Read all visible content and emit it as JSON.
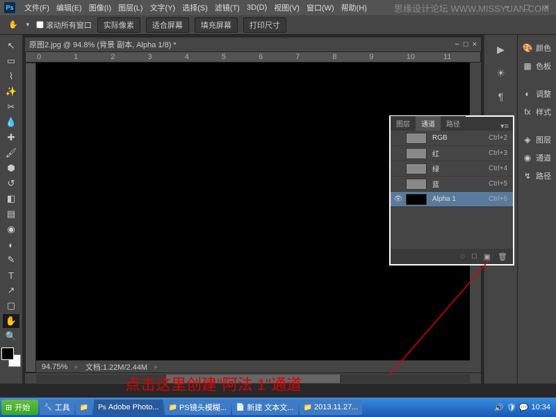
{
  "watermark": "思缘设计论坛  WWW.MISSYUAN.COM",
  "menubar": [
    "文件(F)",
    "编辑(E)",
    "图像(I)",
    "图层(L)",
    "文字(Y)",
    "选择(S)",
    "滤镜(T)",
    "3D(D)",
    "视图(V)",
    "窗口(W)",
    "帮助(H)"
  ],
  "optbar": {
    "scroll_all": "滚动所有窗口",
    "buttons": [
      "实际像素",
      "适合屏幕",
      "填充屏幕",
      "打印尺寸"
    ]
  },
  "doc_title": "原图2.jpg @ 94.8% (背景 副本, Alpha 1/8) *",
  "ruler_marks": [
    "0",
    "1",
    "2",
    "3",
    "4",
    "5",
    "6",
    "7",
    "8",
    "9",
    "10",
    "11"
  ],
  "status": {
    "zoom": "94.75%",
    "doc": "文档:1.22M/2.44M"
  },
  "channels_panel": {
    "tabs": [
      "图层",
      "通道",
      "路径"
    ],
    "active_tab": 1,
    "rows": [
      {
        "name": "RGB",
        "shortcut": "Ctrl+2",
        "eye": false,
        "thumb": "img"
      },
      {
        "name": "红",
        "shortcut": "Ctrl+3",
        "eye": false,
        "thumb": "img"
      },
      {
        "name": "绿",
        "shortcut": "Ctrl+4",
        "eye": false,
        "thumb": "img"
      },
      {
        "name": "蓝",
        "shortcut": "Ctrl+5",
        "eye": false,
        "thumb": "img"
      },
      {
        "name": "Alpha 1",
        "shortcut": "Ctrl+6",
        "eye": true,
        "thumb": "blk",
        "selected": true
      }
    ]
  },
  "right_panel": [
    "颜色",
    "色板",
    "调整",
    "样式",
    "图层",
    "通道",
    "路径"
  ],
  "annotation": "点击这里创建\"阿法 1\"通道",
  "taskbar": {
    "start": "开始",
    "items": [
      "工具",
      "",
      "Adobe Photo...",
      "PS镜头模糊...",
      "新建 文本文...",
      "2013.11.27..."
    ],
    "time": "10:34"
  }
}
